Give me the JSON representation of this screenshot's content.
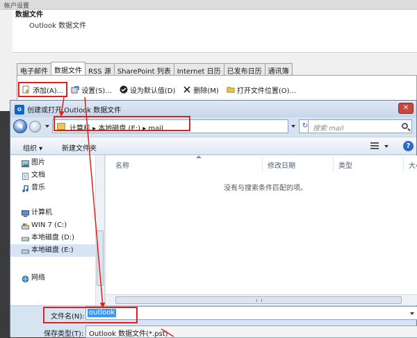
{
  "account_window": {
    "title": "帐户设置",
    "header_title": "数据文件",
    "header_subtitle": "Outlook 数据文件",
    "tabs": [
      {
        "label": "电子邮件"
      },
      {
        "label": "数据文件"
      },
      {
        "label": "RSS 源"
      },
      {
        "label": "SharePoint 列表"
      },
      {
        "label": "Internet 日历"
      },
      {
        "label": "已发布日历"
      },
      {
        "label": "通讯簿"
      }
    ],
    "toolbar": {
      "add": "添加(A)...",
      "settings": "设置(S)...",
      "set_default": "设为默认值(D)",
      "delete": "删除(M)",
      "open_location": "打开文件位置(O)..."
    }
  },
  "dialog": {
    "title": "创建或打开 Outlook 数据文件",
    "logo_text": "O",
    "address": "计算机 ▸ 本地磁盘 (E:) ▸ mail",
    "search_placeholder": "搜索 mail",
    "organize": "组织 ▾",
    "new_folder": "新建文件夹",
    "nav_items": [
      {
        "label": "图片"
      },
      {
        "label": "文档"
      },
      {
        "label": "音乐"
      },
      {
        "label": "计算机"
      },
      {
        "label": "WIN 7 (C:)"
      },
      {
        "label": "本地磁盘 (D:)"
      },
      {
        "label": "本地磁盘 (E:)"
      },
      {
        "label": "网络"
      }
    ],
    "columns": {
      "name": "名称",
      "modified": "修改日期",
      "type": "类型",
      "size": "大小"
    },
    "empty_message": "没有与搜索条件匹配的项。",
    "filename_label": "文件名(N):",
    "filename_value": "outlook",
    "filetype_label": "保存类型(T):",
    "filetype_value": "Outlook 数据文件(*.pst)"
  },
  "colors": {
    "annotation_red": "#e0201a",
    "selection_blue": "#3399ff",
    "dialog_frame": "#d6e3f1"
  }
}
